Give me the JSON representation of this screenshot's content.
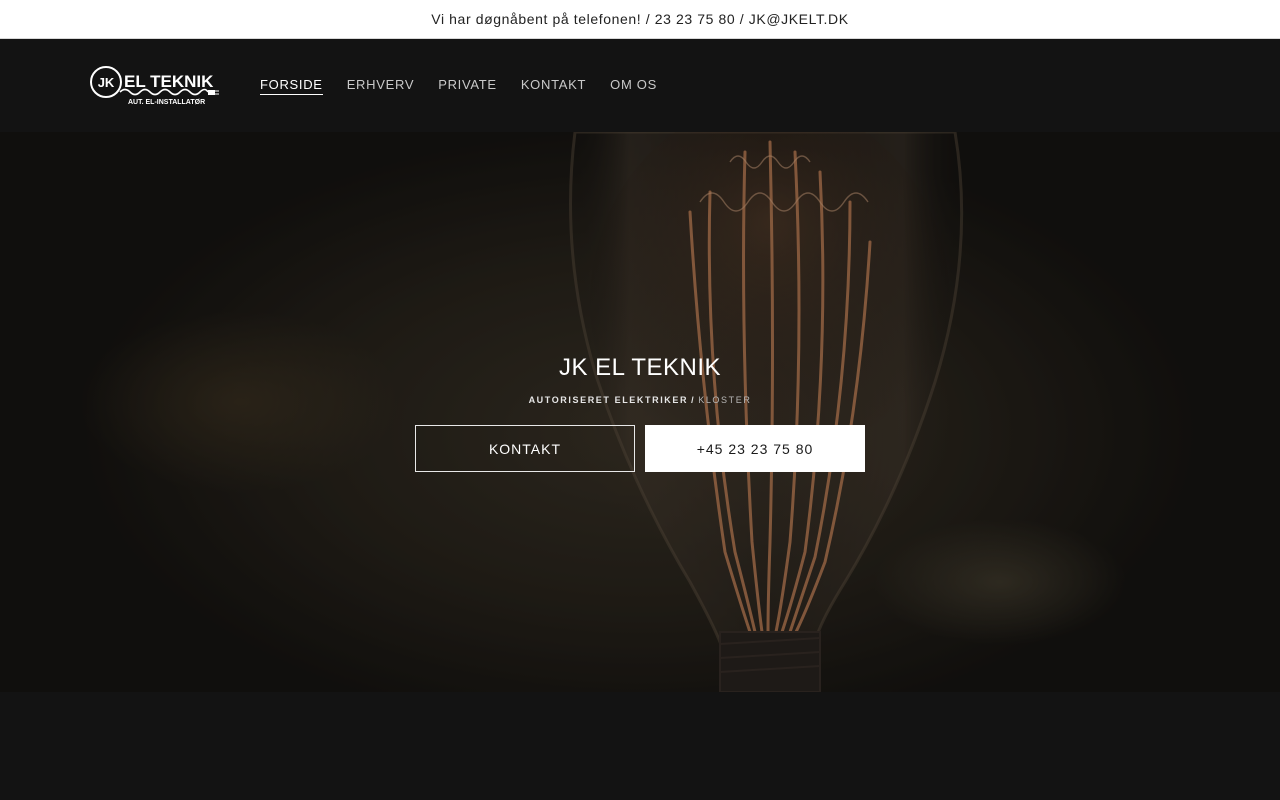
{
  "announcement": {
    "text": "Vi har døgnåbent på telefonen! / 23 23 75 80 / JK@JKELT.DK"
  },
  "logo": {
    "mark": "JK",
    "name": "EL TEKNIK",
    "tagline": "AUT. EL-INSTALLATØR"
  },
  "nav": {
    "items": [
      {
        "label": "FORSIDE",
        "active": true
      },
      {
        "label": "ERHVERV",
        "active": false
      },
      {
        "label": "PRIVATE",
        "active": false
      },
      {
        "label": "KONTAKT",
        "active": false
      },
      {
        "label": "OM OS",
        "active": false
      }
    ]
  },
  "hero": {
    "title": "JK EL TEKNIK",
    "subtitle_strong": "AUTORISERET ELEKTRIKER",
    "subtitle_separator": "/",
    "subtitle_light": "KLOSTER",
    "primary_button": "KONTAKT",
    "secondary_button": "+45 23 23 75 80"
  },
  "colors": {
    "background": "#131313",
    "announcement_bg": "#ffffff",
    "accent_white": "#ffffff",
    "filament": "#c9865a"
  },
  "icons": {
    "logo": "plug-logo-icon"
  }
}
